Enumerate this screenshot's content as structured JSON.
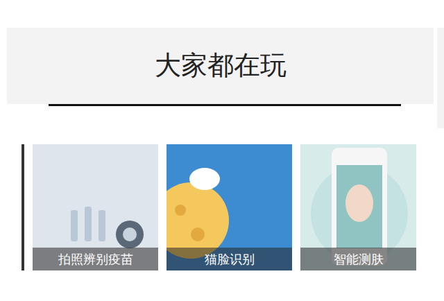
{
  "section": {
    "title": "大家都在玩"
  },
  "cards": [
    {
      "label": "拍照辨别疫苗"
    },
    {
      "label": "猫脸识别"
    },
    {
      "label": "智能测肤"
    }
  ]
}
